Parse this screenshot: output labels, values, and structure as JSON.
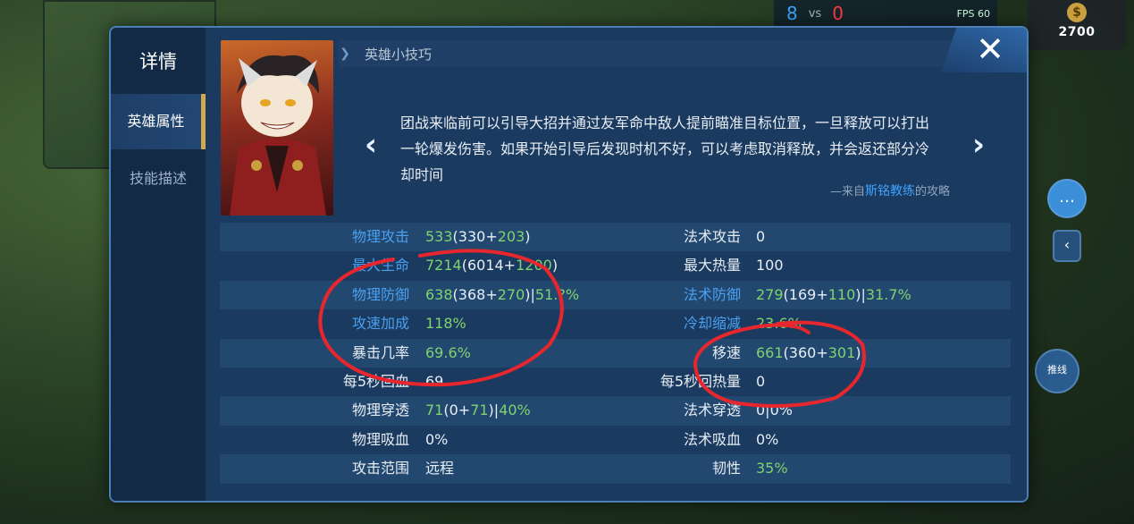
{
  "hud": {
    "score_blue": "8",
    "vs": "vs",
    "score_red": "0",
    "fps": "FPS 60",
    "gold": "2700",
    "push_label": "推线"
  },
  "panel": {
    "nav_title": "详情",
    "nav_items": [
      "英雄属性",
      "技能描述"
    ],
    "active_nav": "英雄属性",
    "tips_title": "英雄小技巧",
    "tip_text": "团战来临前可以引导大招并通过友军命中敌人提前瞄准目标位置，一旦释放可以打出一轮爆发伤害。如果开始引导后发现时机不好，可以考虑取消释放，并会返还部分冷却时间",
    "credit_prefix": "—来自",
    "credit_name": "斯铭教练",
    "credit_suffix": "的攻略",
    "close_icon": "close-icon"
  },
  "stats": [
    {
      "l_label": "物理攻击",
      "l_val": "533",
      "l_paren": "(330+",
      "l_bonus": "203",
      "l_tail": ")",
      "l_pct": "",
      "r_label": "法术攻击",
      "r_val": "0",
      "r_paren": "",
      "r_bonus": "",
      "r_tail": "",
      "r_pct": "",
      "l_blue": true,
      "r_blue": false,
      "shade": true
    },
    {
      "l_label": "最大生命",
      "l_val": "7214",
      "l_paren": "(6014+",
      "l_bonus": "1200",
      "l_tail": ")",
      "l_pct": "",
      "r_label": "最大热量",
      "r_val": "100",
      "r_paren": "",
      "r_bonus": "",
      "r_tail": "",
      "r_pct": "",
      "l_blue": true,
      "r_blue": false,
      "shade": false
    },
    {
      "l_label": "物理防御",
      "l_val": "638",
      "l_paren": "(368+",
      "l_bonus": "270",
      "l_tail": ")|",
      "l_pct": "51.?%",
      "r_label": "法术防御",
      "r_val": "279",
      "r_paren": "(169+",
      "r_bonus": "110",
      "r_tail": ")|",
      "r_pct": "31.7%",
      "l_blue": true,
      "r_blue": true,
      "shade": true
    },
    {
      "l_label": "攻速加成",
      "l_val": "118%",
      "l_paren": "",
      "l_bonus": "",
      "l_tail": "",
      "l_pct": "",
      "r_label": "冷却缩减",
      "r_val": "23.6%",
      "r_paren": "",
      "r_bonus": "",
      "r_tail": "",
      "r_pct": "",
      "l_blue": true,
      "r_blue": true,
      "shade": false
    },
    {
      "l_label": "暴击几率",
      "l_val": "69.6%",
      "l_paren": "",
      "l_bonus": "",
      "l_tail": "",
      "l_pct": "",
      "r_label": "移速",
      "r_val": "661",
      "r_paren": "(360+",
      "r_bonus": "301",
      "r_tail": ")",
      "r_pct": "",
      "l_blue": false,
      "r_blue": false,
      "shade": true
    },
    {
      "l_label": "每5秒回血",
      "l_val": "69",
      "l_paren": "",
      "l_bonus": "",
      "l_tail": "",
      "l_pct": "",
      "r_label": "每5秒回热量",
      "r_val": "0",
      "r_paren": "",
      "r_bonus": "",
      "r_tail": "",
      "r_pct": "",
      "l_blue": false,
      "r_blue": false,
      "shade": false
    },
    {
      "l_label": "物理穿透",
      "l_val": "71",
      "l_paren": "(0+",
      "l_bonus": "71",
      "l_tail": ")|",
      "l_pct": "40%",
      "r_label": "法术穿透",
      "r_val": "0|0%",
      "r_paren": "",
      "r_bonus": "",
      "r_tail": "",
      "r_pct": "",
      "l_blue": false,
      "r_blue": false,
      "shade": true
    },
    {
      "l_label": "物理吸血",
      "l_val": "0%",
      "l_paren": "",
      "l_bonus": "",
      "l_tail": "",
      "l_pct": "",
      "r_label": "法术吸血",
      "r_val": "0%",
      "r_paren": "",
      "r_bonus": "",
      "r_tail": "",
      "r_pct": "",
      "l_blue": false,
      "r_blue": false,
      "shade": false
    },
    {
      "l_label": "攻击范围",
      "l_val": "远程",
      "l_paren": "",
      "l_bonus": "",
      "l_tail": "",
      "l_pct": "",
      "r_label": "韧性",
      "r_val": "35%",
      "r_paren": "",
      "r_bonus": "",
      "r_tail": "",
      "r_pct": "",
      "l_blue": false,
      "r_blue": false,
      "shade": true
    }
  ],
  "colors": {
    "panel_bg": "#1a3556",
    "accent_gold": "#d4a84e",
    "label_blue": "#4aa0ef",
    "bonus_green": "#7fd36f",
    "annotation_red": "#e8262d"
  }
}
